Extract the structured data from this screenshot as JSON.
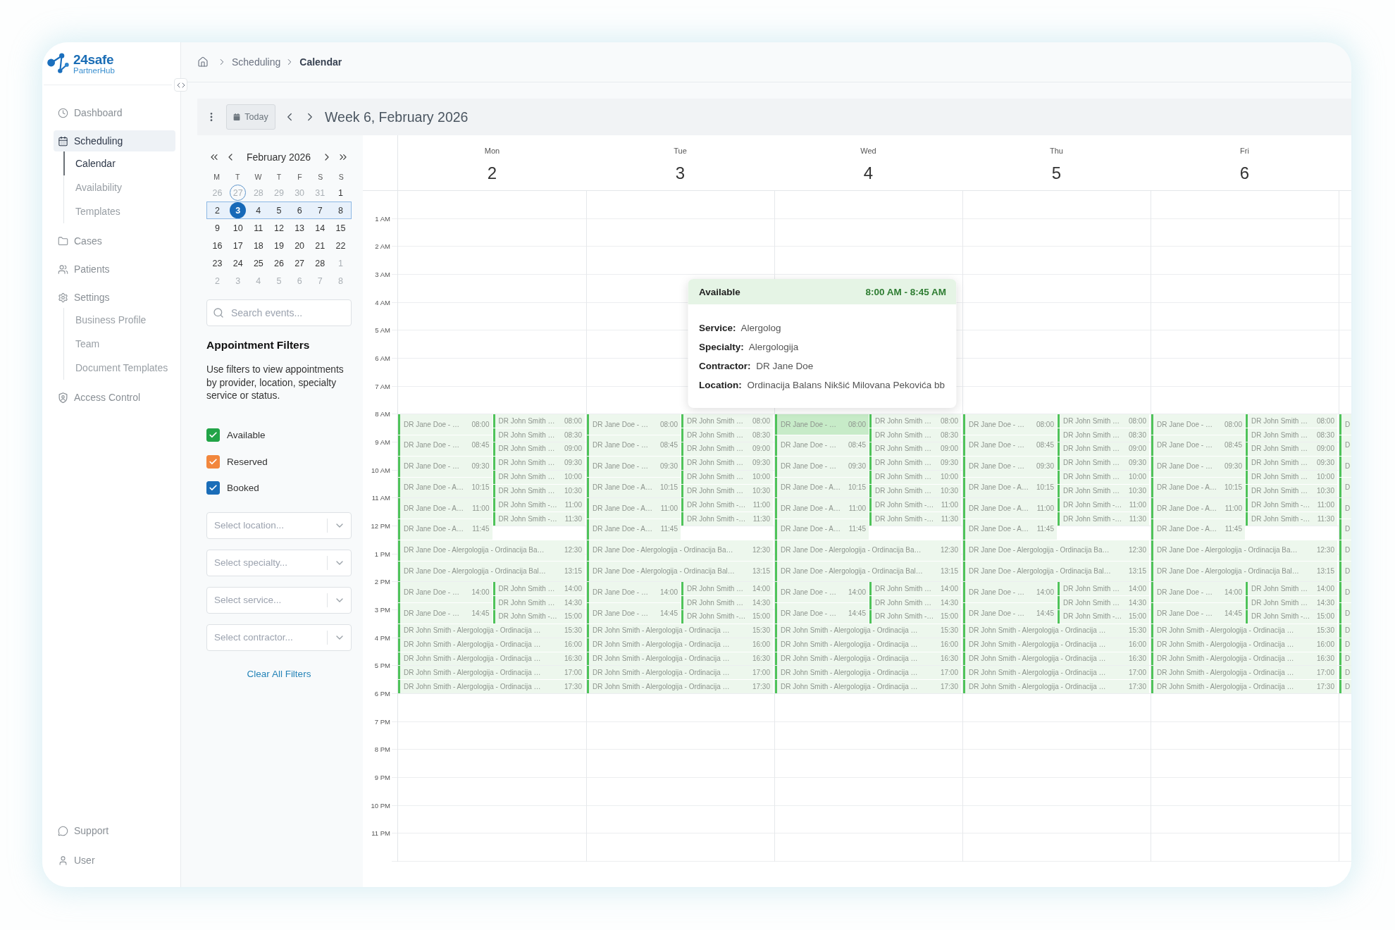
{
  "sidebar": {
    "brand": {
      "name": "24safe",
      "subtitle": "PartnerHub"
    },
    "items": [
      {
        "label": "Dashboard",
        "selected": false
      },
      {
        "label": "Scheduling",
        "selected": true,
        "children": [
          {
            "label": "Calendar",
            "selected": true
          },
          {
            "label": "Availability",
            "selected": false
          },
          {
            "label": "Templates",
            "selected": false
          }
        ]
      },
      {
        "label": "Cases",
        "selected": false
      },
      {
        "label": "Patients",
        "selected": false
      },
      {
        "label": "Settings",
        "selected": false,
        "children": [
          {
            "label": "Business Profile",
            "selected": false
          },
          {
            "label": "Team",
            "selected": false
          },
          {
            "label": "Document Templates",
            "selected": false
          }
        ]
      },
      {
        "label": "Access Control",
        "selected": false
      }
    ],
    "footer_items": [
      {
        "label": "Support"
      },
      {
        "label": "User"
      }
    ]
  },
  "breadcrumb": [
    {
      "label": "Scheduling",
      "current": false
    },
    {
      "label": "Calendar",
      "current": true
    }
  ],
  "toolbar": {
    "today_label": "Today",
    "title": "Week 6, February 2026"
  },
  "mini_calendar": {
    "title": "February 2026",
    "weekdays": [
      "M",
      "T",
      "W",
      "T",
      "F",
      "S",
      "S"
    ],
    "weeks": [
      {
        "selected": false,
        "days": [
          {
            "label": "26",
            "outside": true,
            "today": false,
            "selected": false
          },
          {
            "label": "27",
            "outside": true,
            "today": true,
            "selected": false
          },
          {
            "label": "28",
            "outside": true,
            "today": false,
            "selected": false
          },
          {
            "label": "29",
            "outside": true,
            "today": false,
            "selected": false
          },
          {
            "label": "30",
            "outside": true,
            "today": false,
            "selected": false
          },
          {
            "label": "31",
            "outside": true,
            "today": false,
            "selected": false
          },
          {
            "label": "1",
            "outside": false,
            "today": false,
            "selected": false
          }
        ]
      },
      {
        "selected": true,
        "days": [
          {
            "label": "2",
            "outside": false,
            "today": false,
            "selected": false
          },
          {
            "label": "3",
            "outside": false,
            "today": false,
            "selected": true
          },
          {
            "label": "4",
            "outside": false,
            "today": false,
            "selected": false
          },
          {
            "label": "5",
            "outside": false,
            "today": false,
            "selected": false
          },
          {
            "label": "6",
            "outside": false,
            "today": false,
            "selected": false
          },
          {
            "label": "7",
            "outside": false,
            "today": false,
            "selected": false
          },
          {
            "label": "8",
            "outside": false,
            "today": false,
            "selected": false
          }
        ]
      },
      {
        "selected": false,
        "days": [
          {
            "label": "9",
            "outside": false,
            "today": false,
            "selected": false
          },
          {
            "label": "10",
            "outside": false,
            "today": false,
            "selected": false
          },
          {
            "label": "11",
            "outside": false,
            "today": false,
            "selected": false
          },
          {
            "label": "12",
            "outside": false,
            "today": false,
            "selected": false
          },
          {
            "label": "13",
            "outside": false,
            "today": false,
            "selected": false
          },
          {
            "label": "14",
            "outside": false,
            "today": false,
            "selected": false
          },
          {
            "label": "15",
            "outside": false,
            "today": false,
            "selected": false
          }
        ]
      },
      {
        "selected": false,
        "days": [
          {
            "label": "16",
            "outside": false,
            "today": false,
            "selected": false
          },
          {
            "label": "17",
            "outside": false,
            "today": false,
            "selected": false
          },
          {
            "label": "18",
            "outside": false,
            "today": false,
            "selected": false
          },
          {
            "label": "19",
            "outside": false,
            "today": false,
            "selected": false
          },
          {
            "label": "20",
            "outside": false,
            "today": false,
            "selected": false
          },
          {
            "label": "21",
            "outside": false,
            "today": false,
            "selected": false
          },
          {
            "label": "22",
            "outside": false,
            "today": false,
            "selected": false
          }
        ]
      },
      {
        "selected": false,
        "days": [
          {
            "label": "23",
            "outside": false,
            "today": false,
            "selected": false
          },
          {
            "label": "24",
            "outside": false,
            "today": false,
            "selected": false
          },
          {
            "label": "25",
            "outside": false,
            "today": false,
            "selected": false
          },
          {
            "label": "26",
            "outside": false,
            "today": false,
            "selected": false
          },
          {
            "label": "27",
            "outside": false,
            "today": false,
            "selected": false
          },
          {
            "label": "28",
            "outside": false,
            "today": false,
            "selected": false
          },
          {
            "label": "1",
            "outside": true,
            "today": false,
            "selected": false
          }
        ]
      },
      {
        "selected": false,
        "days": [
          {
            "label": "2",
            "outside": true,
            "today": false,
            "selected": false
          },
          {
            "label": "3",
            "outside": true,
            "today": false,
            "selected": false
          },
          {
            "label": "4",
            "outside": true,
            "today": false,
            "selected": false
          },
          {
            "label": "5",
            "outside": true,
            "today": false,
            "selected": false
          },
          {
            "label": "6",
            "outside": true,
            "today": false,
            "selected": false
          },
          {
            "label": "7",
            "outside": true,
            "today": false,
            "selected": false
          },
          {
            "label": "8",
            "outside": true,
            "today": false,
            "selected": false
          }
        ]
      }
    ]
  },
  "filters": {
    "search": {
      "placeholder": "Search events..."
    },
    "title": "Appointment Filters",
    "description": "Use filters to view appointments by provider, location, specialty service or status.",
    "statuses": [
      {
        "label": "Available",
        "checked": true,
        "color": "#22a447"
      },
      {
        "label": "Reserved",
        "checked": true,
        "color": "#f2873d"
      },
      {
        "label": "Booked",
        "checked": true,
        "color": "#1b6db8"
      }
    ],
    "selects": [
      {
        "placeholder": "Select location..."
      },
      {
        "placeholder": "Select specialty..."
      },
      {
        "placeholder": "Select service..."
      },
      {
        "placeholder": "Select contractor..."
      }
    ],
    "clear_link": "Clear All Filters"
  },
  "calendar": {
    "hours": [
      "1 AM",
      "2 AM",
      "3 AM",
      "4 AM",
      "5 AM",
      "6 AM",
      "7 AM",
      "8 AM",
      "9 AM",
      "10 AM",
      "11 AM",
      "12 PM",
      "1 PM",
      "2 PM",
      "3 PM",
      "4 PM",
      "5 PM",
      "6 PM",
      "7 PM",
      "8 PM",
      "9 PM",
      "10 PM",
      "11 PM"
    ],
    "days": [
      {
        "name": "Mon",
        "date": "2",
        "cut_off": false,
        "events": [
          {
            "kind": "left",
            "label": "DR Jane Doe - …",
            "time": "08:00",
            "long": true,
            "selected": false
          },
          {
            "kind": "right",
            "label": "DR John Smith …",
            "time": "08:00",
            "long": false,
            "selected": false
          },
          {
            "kind": "right",
            "label": "DR John Smith …",
            "time": "08:30",
            "long": false,
            "selected": false
          },
          {
            "kind": "left",
            "label": "DR Jane Doe - …",
            "time": "08:45",
            "long": true,
            "selected": false
          },
          {
            "kind": "right",
            "label": "DR John Smith …",
            "time": "09:00",
            "long": false,
            "selected": false
          },
          {
            "kind": "left",
            "label": "DR Jane Doe - …",
            "time": "09:30",
            "long": true,
            "selected": false
          },
          {
            "kind": "right",
            "label": "DR John Smith …",
            "time": "09:30",
            "long": false,
            "selected": false
          },
          {
            "kind": "right",
            "label": "DR John Smith …",
            "time": "10:00",
            "long": false,
            "selected": false
          },
          {
            "kind": "left",
            "label": "DR Jane Doe - A…",
            "time": "10:15",
            "long": true,
            "selected": false
          },
          {
            "kind": "right",
            "label": "DR John Smith …",
            "time": "10:30",
            "long": false,
            "selected": false
          },
          {
            "kind": "left",
            "label": "DR Jane Doe - A…",
            "time": "11:00",
            "long": true,
            "selected": false
          },
          {
            "kind": "right",
            "label": "DR John Smith -…",
            "time": "11:00",
            "long": false,
            "selected": false
          },
          {
            "kind": "right",
            "label": "DR John Smith -…",
            "time": "11:30",
            "long": false,
            "selected": false
          },
          {
            "kind": "left",
            "label": "DR Jane Doe - A…",
            "time": "11:45",
            "long": true,
            "selected": false
          },
          {
            "kind": "full",
            "label": "DR Jane Doe - Alergologija - Ordinacija Ba…",
            "time": "12:30",
            "long": true,
            "selected": false
          },
          {
            "kind": "full",
            "label": "DR Jane Doe - Alergologija - Ordinacija Bal…",
            "time": "13:15",
            "long": true,
            "selected": false
          },
          {
            "kind": "left",
            "label": "DR Jane Doe - …",
            "time": "14:00",
            "long": true,
            "selected": false
          },
          {
            "kind": "right",
            "label": "DR John Smith …",
            "time": "14:00",
            "long": false,
            "selected": false
          },
          {
            "kind": "right",
            "label": "DR John Smith …",
            "time": "14:30",
            "long": false,
            "selected": false
          },
          {
            "kind": "left",
            "label": "DR Jane Doe - …",
            "time": "14:45",
            "long": true,
            "selected": false
          },
          {
            "kind": "right",
            "label": "DR John Smith -…",
            "time": "15:00",
            "long": false,
            "selected": false
          },
          {
            "kind": "full",
            "label": "DR John Smith - Alergologija - Ordinacija …",
            "time": "15:30",
            "long": false,
            "selected": false
          },
          {
            "kind": "full",
            "label": "DR John Smith - Alergologija - Ordinacija …",
            "time": "16:00",
            "long": false,
            "selected": false
          },
          {
            "kind": "full",
            "label": "DR John Smith - Alergologija - Ordinacija …",
            "time": "16:30",
            "long": false,
            "selected": false
          },
          {
            "kind": "full",
            "label": "DR John Smith - Alergologija - Ordinacija …",
            "time": "17:00",
            "long": false,
            "selected": false
          },
          {
            "kind": "full",
            "label": "DR John Smith - Alergologija - Ordinacija …",
            "time": "17:30",
            "long": false,
            "selected": false
          }
        ]
      },
      {
        "name": "Tue",
        "date": "3",
        "cut_off": false,
        "events": [
          {
            "kind": "left",
            "label": "DR Jane Doe - …",
            "time": "08:00",
            "long": true,
            "selected": false
          },
          {
            "kind": "right",
            "label": "DR John Smith …",
            "time": "08:00",
            "long": false,
            "selected": false
          },
          {
            "kind": "right",
            "label": "DR John Smith …",
            "time": "08:30",
            "long": false,
            "selected": false
          },
          {
            "kind": "left",
            "label": "DR Jane Doe - …",
            "time": "08:45",
            "long": true,
            "selected": false
          },
          {
            "kind": "right",
            "label": "DR John Smith …",
            "time": "09:00",
            "long": false,
            "selected": false
          },
          {
            "kind": "left",
            "label": "DR Jane Doe - …",
            "time": "09:30",
            "long": true,
            "selected": false
          },
          {
            "kind": "right",
            "label": "DR John Smith …",
            "time": "09:30",
            "long": false,
            "selected": false
          },
          {
            "kind": "right",
            "label": "DR John Smith …",
            "time": "10:00",
            "long": false,
            "selected": false
          },
          {
            "kind": "left",
            "label": "DR Jane Doe - A…",
            "time": "10:15",
            "long": true,
            "selected": false
          },
          {
            "kind": "right",
            "label": "DR John Smith …",
            "time": "10:30",
            "long": false,
            "selected": false
          },
          {
            "kind": "left",
            "label": "DR Jane Doe - A…",
            "time": "11:00",
            "long": true,
            "selected": false
          },
          {
            "kind": "right",
            "label": "DR John Smith -…",
            "time": "11:00",
            "long": false,
            "selected": false
          },
          {
            "kind": "right",
            "label": "DR John Smith -…",
            "time": "11:30",
            "long": false,
            "selected": false
          },
          {
            "kind": "left",
            "label": "DR Jane Doe - A…",
            "time": "11:45",
            "long": true,
            "selected": false
          },
          {
            "kind": "full",
            "label": "DR Jane Doe - Alergologija - Ordinacija Ba…",
            "time": "12:30",
            "long": true,
            "selected": false
          },
          {
            "kind": "full",
            "label": "DR Jane Doe - Alergologija - Ordinacija Bal…",
            "time": "13:15",
            "long": true,
            "selected": false
          },
          {
            "kind": "left",
            "label": "DR Jane Doe - …",
            "time": "14:00",
            "long": true,
            "selected": false
          },
          {
            "kind": "right",
            "label": "DR John Smith …",
            "time": "14:00",
            "long": false,
            "selected": false
          },
          {
            "kind": "right",
            "label": "DR John Smith …",
            "time": "14:30",
            "long": false,
            "selected": false
          },
          {
            "kind": "left",
            "label": "DR Jane Doe - …",
            "time": "14:45",
            "long": true,
            "selected": false
          },
          {
            "kind": "right",
            "label": "DR John Smith -…",
            "time": "15:00",
            "long": false,
            "selected": false
          },
          {
            "kind": "full",
            "label": "DR John Smith - Alergologija - Ordinacija …",
            "time": "15:30",
            "long": false,
            "selected": false
          },
          {
            "kind": "full",
            "label": "DR John Smith - Alergologija - Ordinacija …",
            "time": "16:00",
            "long": false,
            "selected": false
          },
          {
            "kind": "full",
            "label": "DR John Smith - Alergologija - Ordinacija …",
            "time": "16:30",
            "long": false,
            "selected": false
          },
          {
            "kind": "full",
            "label": "DR John Smith - Alergologija - Ordinacija …",
            "time": "17:00",
            "long": false,
            "selected": false
          },
          {
            "kind": "full",
            "label": "DR John Smith - Alergologija - Ordinacija …",
            "time": "17:30",
            "long": false,
            "selected": false
          }
        ]
      },
      {
        "name": "Wed",
        "date": "4",
        "cut_off": false,
        "events": [
          {
            "kind": "left",
            "label": "DR Jane Doe - …",
            "time": "08:00",
            "long": true,
            "selected": true
          },
          {
            "kind": "right",
            "label": "DR John Smith …",
            "time": "08:00",
            "long": false,
            "selected": false
          },
          {
            "kind": "right",
            "label": "DR John Smith …",
            "time": "08:30",
            "long": false,
            "selected": false
          },
          {
            "kind": "left",
            "label": "DR Jane Doe - …",
            "time": "08:45",
            "long": true,
            "selected": false
          },
          {
            "kind": "right",
            "label": "DR John Smith …",
            "time": "09:00",
            "long": false,
            "selected": false
          },
          {
            "kind": "left",
            "label": "DR Jane Doe - …",
            "time": "09:30",
            "long": true,
            "selected": false
          },
          {
            "kind": "right",
            "label": "DR John Smith …",
            "time": "09:30",
            "long": false,
            "selected": false
          },
          {
            "kind": "right",
            "label": "DR John Smith …",
            "time": "10:00",
            "long": false,
            "selected": false
          },
          {
            "kind": "left",
            "label": "DR Jane Doe - A…",
            "time": "10:15",
            "long": true,
            "selected": false
          },
          {
            "kind": "right",
            "label": "DR John Smith …",
            "time": "10:30",
            "long": false,
            "selected": false
          },
          {
            "kind": "left",
            "label": "DR Jane Doe - A…",
            "time": "11:00",
            "long": true,
            "selected": false
          },
          {
            "kind": "right",
            "label": "DR John Smith -…",
            "time": "11:00",
            "long": false,
            "selected": false
          },
          {
            "kind": "right",
            "label": "DR John Smith -…",
            "time": "11:30",
            "long": false,
            "selected": false
          },
          {
            "kind": "left",
            "label": "DR Jane Doe - A…",
            "time": "11:45",
            "long": true,
            "selected": false
          },
          {
            "kind": "full",
            "label": "DR Jane Doe - Alergologija - Ordinacija Ba…",
            "time": "12:30",
            "long": true,
            "selected": false
          },
          {
            "kind": "full",
            "label": "DR Jane Doe - Alergologija - Ordinacija Bal…",
            "time": "13:15",
            "long": true,
            "selected": false
          },
          {
            "kind": "left",
            "label": "DR Jane Doe - …",
            "time": "14:00",
            "long": true,
            "selected": false
          },
          {
            "kind": "right",
            "label": "DR John Smith …",
            "time": "14:00",
            "long": false,
            "selected": false
          },
          {
            "kind": "right",
            "label": "DR John Smith …",
            "time": "14:30",
            "long": false,
            "selected": false
          },
          {
            "kind": "left",
            "label": "DR Jane Doe - …",
            "time": "14:45",
            "long": true,
            "selected": false
          },
          {
            "kind": "right",
            "label": "DR John Smith -…",
            "time": "15:00",
            "long": false,
            "selected": false
          },
          {
            "kind": "full",
            "label": "DR John Smith - Alergologija - Ordinacija …",
            "time": "15:30",
            "long": false,
            "selected": false
          },
          {
            "kind": "full",
            "label": "DR John Smith - Alergologija - Ordinacija …",
            "time": "16:00",
            "long": false,
            "selected": false
          },
          {
            "kind": "full",
            "label": "DR John Smith - Alergologija - Ordinacija …",
            "time": "16:30",
            "long": false,
            "selected": false
          },
          {
            "kind": "full",
            "label": "DR John Smith - Alergologija - Ordinacija …",
            "time": "17:00",
            "long": false,
            "selected": false
          },
          {
            "kind": "full",
            "label": "DR John Smith - Alergologija - Ordinacija …",
            "time": "17:30",
            "long": false,
            "selected": false
          }
        ]
      },
      {
        "name": "Thu",
        "date": "5",
        "cut_off": false,
        "events": [
          {
            "kind": "left",
            "label": "DR Jane Doe - …",
            "time": "08:00",
            "long": true,
            "selected": false
          },
          {
            "kind": "right",
            "label": "DR John Smith …",
            "time": "08:00",
            "long": false,
            "selected": false
          },
          {
            "kind": "right",
            "label": "DR John Smith …",
            "time": "08:30",
            "long": false,
            "selected": false
          },
          {
            "kind": "left",
            "label": "DR Jane Doe - …",
            "time": "08:45",
            "long": true,
            "selected": false
          },
          {
            "kind": "right",
            "label": "DR John Smith …",
            "time": "09:00",
            "long": false,
            "selected": false
          },
          {
            "kind": "left",
            "label": "DR Jane Doe - …",
            "time": "09:30",
            "long": true,
            "selected": false
          },
          {
            "kind": "right",
            "label": "DR John Smith …",
            "time": "09:30",
            "long": false,
            "selected": false
          },
          {
            "kind": "right",
            "label": "DR John Smith …",
            "time": "10:00",
            "long": false,
            "selected": false
          },
          {
            "kind": "left",
            "label": "DR Jane Doe - A…",
            "time": "10:15",
            "long": true,
            "selected": false
          },
          {
            "kind": "right",
            "label": "DR John Smith …",
            "time": "10:30",
            "long": false,
            "selected": false
          },
          {
            "kind": "left",
            "label": "DR Jane Doe - A…",
            "time": "11:00",
            "long": true,
            "selected": false
          },
          {
            "kind": "right",
            "label": "DR John Smith -…",
            "time": "11:00",
            "long": false,
            "selected": false
          },
          {
            "kind": "right",
            "label": "DR John Smith -…",
            "time": "11:30",
            "long": false,
            "selected": false
          },
          {
            "kind": "left",
            "label": "DR Jane Doe - A…",
            "time": "11:45",
            "long": true,
            "selected": false
          },
          {
            "kind": "full",
            "label": "DR Jane Doe - Alergologija - Ordinacija Ba…",
            "time": "12:30",
            "long": true,
            "selected": false
          },
          {
            "kind": "full",
            "label": "DR Jane Doe - Alergologija - Ordinacija Bal…",
            "time": "13:15",
            "long": true,
            "selected": false
          },
          {
            "kind": "left",
            "label": "DR Jane Doe - …",
            "time": "14:00",
            "long": true,
            "selected": false
          },
          {
            "kind": "right",
            "label": "DR John Smith …",
            "time": "14:00",
            "long": false,
            "selected": false
          },
          {
            "kind": "right",
            "label": "DR John Smith …",
            "time": "14:30",
            "long": false,
            "selected": false
          },
          {
            "kind": "left",
            "label": "DR Jane Doe - …",
            "time": "14:45",
            "long": true,
            "selected": false
          },
          {
            "kind": "right",
            "label": "DR John Smith -…",
            "time": "15:00",
            "long": false,
            "selected": false
          },
          {
            "kind": "full",
            "label": "DR John Smith - Alergologija - Ordinacija …",
            "time": "15:30",
            "long": false,
            "selected": false
          },
          {
            "kind": "full",
            "label": "DR John Smith - Alergologija - Ordinacija …",
            "time": "16:00",
            "long": false,
            "selected": false
          },
          {
            "kind": "full",
            "label": "DR John Smith - Alergologija - Ordinacija …",
            "time": "16:30",
            "long": false,
            "selected": false
          },
          {
            "kind": "full",
            "label": "DR John Smith - Alergologija - Ordinacija …",
            "time": "17:00",
            "long": false,
            "selected": false
          },
          {
            "kind": "full",
            "label": "DR John Smith - Alergologija - Ordinacija …",
            "time": "17:30",
            "long": false,
            "selected": false
          }
        ]
      },
      {
        "name": "Fri",
        "date": "6",
        "cut_off": false,
        "events": [
          {
            "kind": "left",
            "label": "DR Jane Doe - …",
            "time": "08:00",
            "long": true,
            "selected": false
          },
          {
            "kind": "right",
            "label": "DR John Smith …",
            "time": "08:00",
            "long": false,
            "selected": false
          },
          {
            "kind": "right",
            "label": "DR John Smith …",
            "time": "08:30",
            "long": false,
            "selected": false
          },
          {
            "kind": "left",
            "label": "DR Jane Doe - …",
            "time": "08:45",
            "long": true,
            "selected": false
          },
          {
            "kind": "right",
            "label": "DR John Smith …",
            "time": "09:00",
            "long": false,
            "selected": false
          },
          {
            "kind": "left",
            "label": "DR Jane Doe - …",
            "time": "09:30",
            "long": true,
            "selected": false
          },
          {
            "kind": "right",
            "label": "DR John Smith …",
            "time": "09:30",
            "long": false,
            "selected": false
          },
          {
            "kind": "right",
            "label": "DR John Smith …",
            "time": "10:00",
            "long": false,
            "selected": false
          },
          {
            "kind": "left",
            "label": "DR Jane Doe - A…",
            "time": "10:15",
            "long": true,
            "selected": false
          },
          {
            "kind": "right",
            "label": "DR John Smith …",
            "time": "10:30",
            "long": false,
            "selected": false
          },
          {
            "kind": "left",
            "label": "DR Jane Doe - A…",
            "time": "11:00",
            "long": true,
            "selected": false
          },
          {
            "kind": "right",
            "label": "DR John Smith -…",
            "time": "11:00",
            "long": false,
            "selected": false
          },
          {
            "kind": "right",
            "label": "DR John Smith -…",
            "time": "11:30",
            "long": false,
            "selected": false
          },
          {
            "kind": "left",
            "label": "DR Jane Doe - A…",
            "time": "11:45",
            "long": true,
            "selected": false
          },
          {
            "kind": "full",
            "label": "DR Jane Doe - Alergologija - Ordinacija Ba…",
            "time": "12:30",
            "long": true,
            "selected": false
          },
          {
            "kind": "full",
            "label": "DR Jane Doe - Alergologija - Ordinacija Bal…",
            "time": "13:15",
            "long": true,
            "selected": false
          },
          {
            "kind": "left",
            "label": "DR Jane Doe - …",
            "time": "14:00",
            "long": true,
            "selected": false
          },
          {
            "kind": "right",
            "label": "DR John Smith …",
            "time": "14:00",
            "long": false,
            "selected": false
          },
          {
            "kind": "right",
            "label": "DR John Smith …",
            "time": "14:30",
            "long": false,
            "selected": false
          },
          {
            "kind": "left",
            "label": "DR Jane Doe - …",
            "time": "14:45",
            "long": true,
            "selected": false
          },
          {
            "kind": "right",
            "label": "DR John Smith -…",
            "time": "15:00",
            "long": false,
            "selected": false
          },
          {
            "kind": "full",
            "label": "DR John Smith - Alergologija - Ordinacija …",
            "time": "15:30",
            "long": false,
            "selected": false
          },
          {
            "kind": "full",
            "label": "DR John Smith - Alergologija - Ordinacija …",
            "time": "16:00",
            "long": false,
            "selected": false
          },
          {
            "kind": "full",
            "label": "DR John Smith - Alergologija - Ordinacija …",
            "time": "16:30",
            "long": false,
            "selected": false
          },
          {
            "kind": "full",
            "label": "DR John Smith - Alergologija - Ordinacija …",
            "time": "17:00",
            "long": false,
            "selected": false
          },
          {
            "kind": "full",
            "label": "DR John Smith - Alergologija - Ordinacija …",
            "time": "17:30",
            "long": false,
            "selected": false
          }
        ]
      },
      {
        "cut_off": true,
        "events": [
          {
            "kind": "left",
            "label": "D",
            "long": true,
            "selected": false
          },
          {
            "kind": "left",
            "label": "D",
            "long": true,
            "selected": false
          },
          {
            "kind": "left",
            "label": "D",
            "long": true,
            "selected": false
          },
          {
            "kind": "left",
            "label": "D",
            "long": true,
            "selected": false
          },
          {
            "kind": "left",
            "label": "D",
            "long": true,
            "selected": false
          },
          {
            "kind": "left",
            "label": "D",
            "long": true,
            "selected": false
          },
          {
            "kind": "full",
            "label": "D",
            "long": true,
            "selected": false
          },
          {
            "kind": "full",
            "label": "D",
            "long": true,
            "selected": false
          },
          {
            "kind": "left",
            "label": "D",
            "long": true,
            "selected": false
          },
          {
            "kind": "left",
            "label": "D",
            "long": true,
            "selected": false
          },
          {
            "kind": "full",
            "label": "D",
            "long": false,
            "selected": false
          },
          {
            "kind": "full",
            "label": "D",
            "long": false,
            "selected": false
          },
          {
            "kind": "full",
            "label": "D",
            "long": false,
            "selected": false
          },
          {
            "kind": "full",
            "label": "D",
            "long": false,
            "selected": false
          },
          {
            "kind": "full",
            "label": "D",
            "long": false,
            "selected": false
          }
        ]
      }
    ],
    "popover": {
      "title": "Available",
      "time": "8:00 AM - 8:45 AM",
      "fields": [
        {
          "label": "Service:",
          "value": "Alergolog"
        },
        {
          "label": "Specialty:",
          "value": "Alergologija"
        },
        {
          "label": "Contractor:",
          "value": "DR Jane Doe"
        },
        {
          "label": "Location:",
          "value": "Ordinacija Balans Nikšić Milovana Pekovića bb"
        }
      ]
    }
  }
}
